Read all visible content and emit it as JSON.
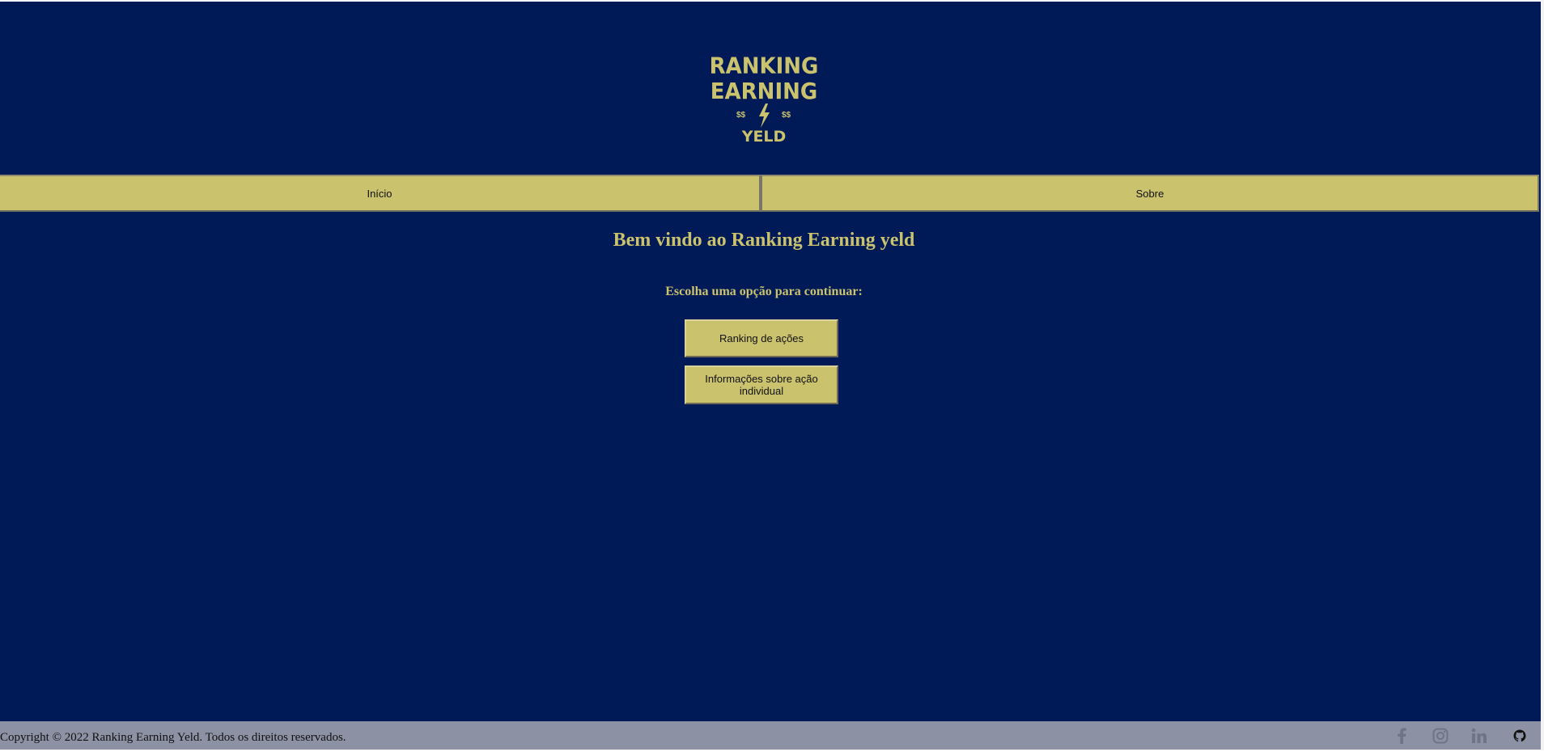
{
  "logo": {
    "line1": "RANKING EARNING",
    "symbol_left": "$$",
    "symbol_right": "$$",
    "line2": "YELD",
    "accent": "#cbc26e"
  },
  "nav": {
    "items": [
      {
        "label": "Início"
      },
      {
        "label": "Sobre"
      }
    ]
  },
  "main": {
    "title": "Bem vindo ao Ranking Earning yeld",
    "prompt": "Escolha uma opção para continuar:",
    "buttons": [
      {
        "label": "Ranking de ações"
      },
      {
        "label": "Informações sobre ação individual"
      }
    ]
  },
  "footer": {
    "copyright": "Copyright © 2022 Ranking Earning Yeld. Todos os direitos reservados.",
    "social": [
      "facebook-icon",
      "instagram-icon",
      "linkedin-icon",
      "github-icon"
    ]
  },
  "colors": {
    "background": "#001a57",
    "accent": "#cbc26e",
    "footer": "#8c92a4"
  }
}
